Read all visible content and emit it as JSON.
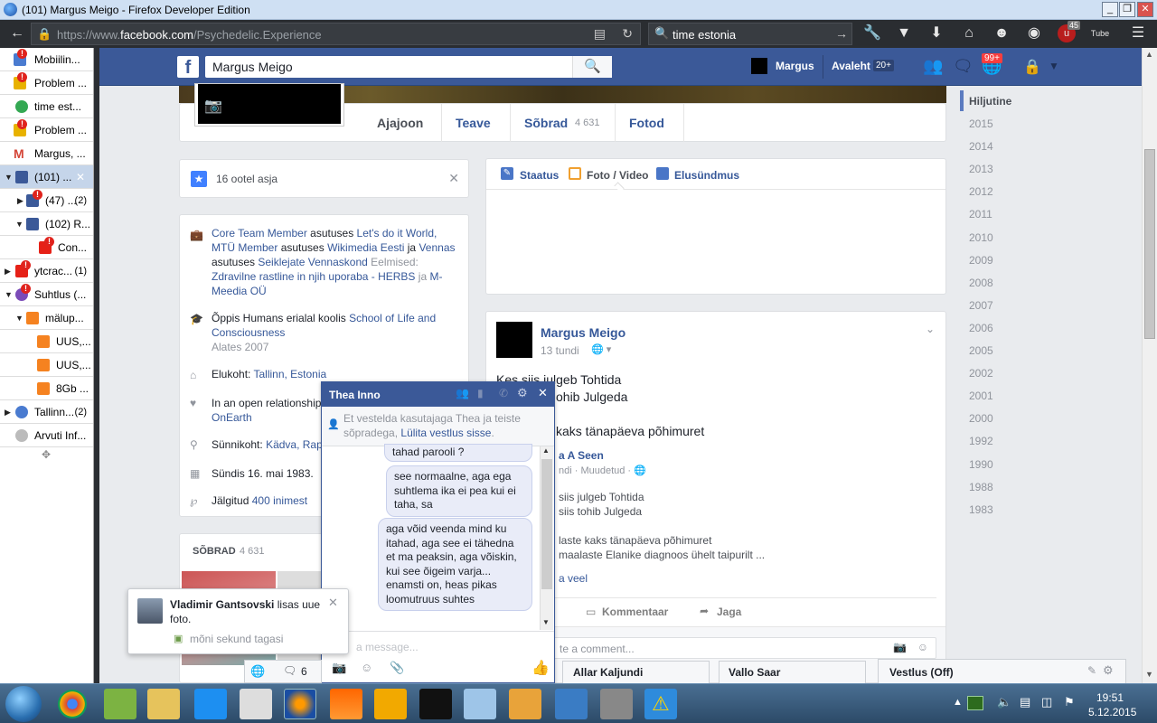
{
  "window": {
    "title": "(101) Margus Meigo - Firefox Developer Edition",
    "min": "_",
    "max": "❐",
    "close": "✕"
  },
  "nav": {
    "url_prefix": "https://www.",
    "url_domain": "facebook.com",
    "url_path": "/Psychedelic.Experience",
    "search": "time estonia",
    "badge": "45",
    "accent": "#2a2d31"
  },
  "tabs": [
    {
      "label": "Mobiilin...",
      "count": "",
      "color": "#4a7bd0"
    },
    {
      "label": "Problem ...",
      "count": "",
      "color": "#e8b200"
    },
    {
      "label": "time est...",
      "count": "",
      "color": "#34a853"
    },
    {
      "label": "Problem ...",
      "count": "",
      "color": "#e8b200"
    },
    {
      "label": "Margus, ...",
      "count": "",
      "color": "#d44638"
    },
    {
      "label": "(101) ...",
      "count": "",
      "color": "#3b5998"
    },
    {
      "label": "(47) ...",
      "count": "(2)",
      "color": "#3b5998"
    },
    {
      "label": "(102) R...",
      "count": "",
      "color": "#3b5998"
    },
    {
      "label": "Con...",
      "count": "",
      "color": "#e62117"
    },
    {
      "label": "ytcrac...",
      "count": "(1)",
      "color": "#e62117"
    },
    {
      "label": "Suhtlus (...",
      "count": "",
      "color": "#7b4bb8"
    },
    {
      "label": "mälup...",
      "count": "",
      "color": "#f58220"
    },
    {
      "label": "UUS,...",
      "count": "",
      "color": "#f58220"
    },
    {
      "label": "UUS,...",
      "count": "",
      "color": "#f58220"
    },
    {
      "label": "8Gb ...",
      "count": "",
      "color": "#f58220"
    },
    {
      "label": "Tallinn...",
      "count": "(2)",
      "color": "#4a7bd0"
    },
    {
      "label": "Arvuti Inf...",
      "count": "",
      "color": "#bbbbbb"
    }
  ],
  "fb": {
    "search": "Margus Meigo",
    "user": "Margus",
    "home": "Avaleht",
    "home_badge": "20+",
    "notif": "99+",
    "profile_tabs": [
      "Ajajoon",
      "Teave",
      "Sõbrad",
      "Fotod"
    ],
    "friends_count": "4 631",
    "pending": "16 ootel asja",
    "about": {
      "work1_a": "Core Team Member",
      "at": "asutuses",
      "work1_b": "Let's do it World, MTÜ Member",
      "work1_c": "Wikimedia Eesti",
      "ja": "ja",
      "work1_d": "Vennas",
      "work1_e": "Seiklejate Vennaskond",
      "prev": "Eelmised:",
      "prev_a": "Zdravilne rastline in njih uporaba - HERBS",
      "prev_b": "M-Meedia OÜ",
      "study_pre": "Õppis Humans erialal koolis",
      "study_school": "School of Life and Consciousness",
      "study_since": "Alates 2007",
      "lives_pre": "Elukoht:",
      "lives": "Tallinn, Estonia",
      "rel_pre": "In an open relationship",
      "rel_link": "OnEarth",
      "born_pre": "Sünnikoht:",
      "born": "Kädva, Rap",
      "birthday": "Sündis 16. mai 1983.",
      "follow_pre": "Jälgitud",
      "follow": "400 inimest"
    },
    "friends_header": "SÕBRAD",
    "friends_num": "4 631",
    "composer": {
      "status": "Staatus",
      "photo": "Foto / Video",
      "event": "Elusündmus"
    },
    "post": {
      "author": "Margus Meigo",
      "time": "13 tundi",
      "l1": "Kes siis julgeb Tohtida",
      "l2": "ohib Julgeda",
      "l3": "kaks tänapäeva põhimuret",
      "shared_author": "a A Seen",
      "shared_meta": "ndi · Muudetud ·",
      "s1": "siis julgeb Tohtida",
      "s2": "siis tohib Julgeda",
      "s3": "laste kaks tänapäeva põhimuret",
      "s4": "maalaste Elanike diagnoos ühelt taipurilt ...",
      "more": "a veel",
      "comment": "Kommentaar",
      "share": "Jaga",
      "comment_ph": "te a comment..."
    },
    "timeline_active": "Hiljutine",
    "years": [
      "2015",
      "2014",
      "2013",
      "2012",
      "2011",
      "2010",
      "2009",
      "2008",
      "2007",
      "2006",
      "2005",
      "2002",
      "2001",
      "2000",
      "1992",
      "1990",
      "1988",
      "1983"
    ]
  },
  "chat": {
    "name": "Thea Inno",
    "notice_pre": "Et vestelda kasutajaga Thea ja teiste sõpradega,",
    "notice_link": "Lülita vestlus sisse",
    "notice_end": ".",
    "m0": "tahad parooli ?",
    "m1": "see normaalne, aga ega suhtlema ika ei pea kui ei taha, sa",
    "m2": "aga võid veenda mind ku itahad, aga see ei tähedna et ma peaksin, aga võiskin, kui see õigeim varja... enamsti on, heas pikas loomutruus suhtes",
    "input_ph": "a message..."
  },
  "notif": {
    "name": "Vladimir Gantsovski",
    "text": "lisas uue foto.",
    "time": "mõni sekund tagasi"
  },
  "dock": {
    "friend1": "Allar Kaljundi",
    "friend2": "Vallo Saar",
    "status": "Vestlus (Off)",
    "count": "6"
  },
  "clock": {
    "time": "19:51",
    "date": "5.12.2015"
  }
}
